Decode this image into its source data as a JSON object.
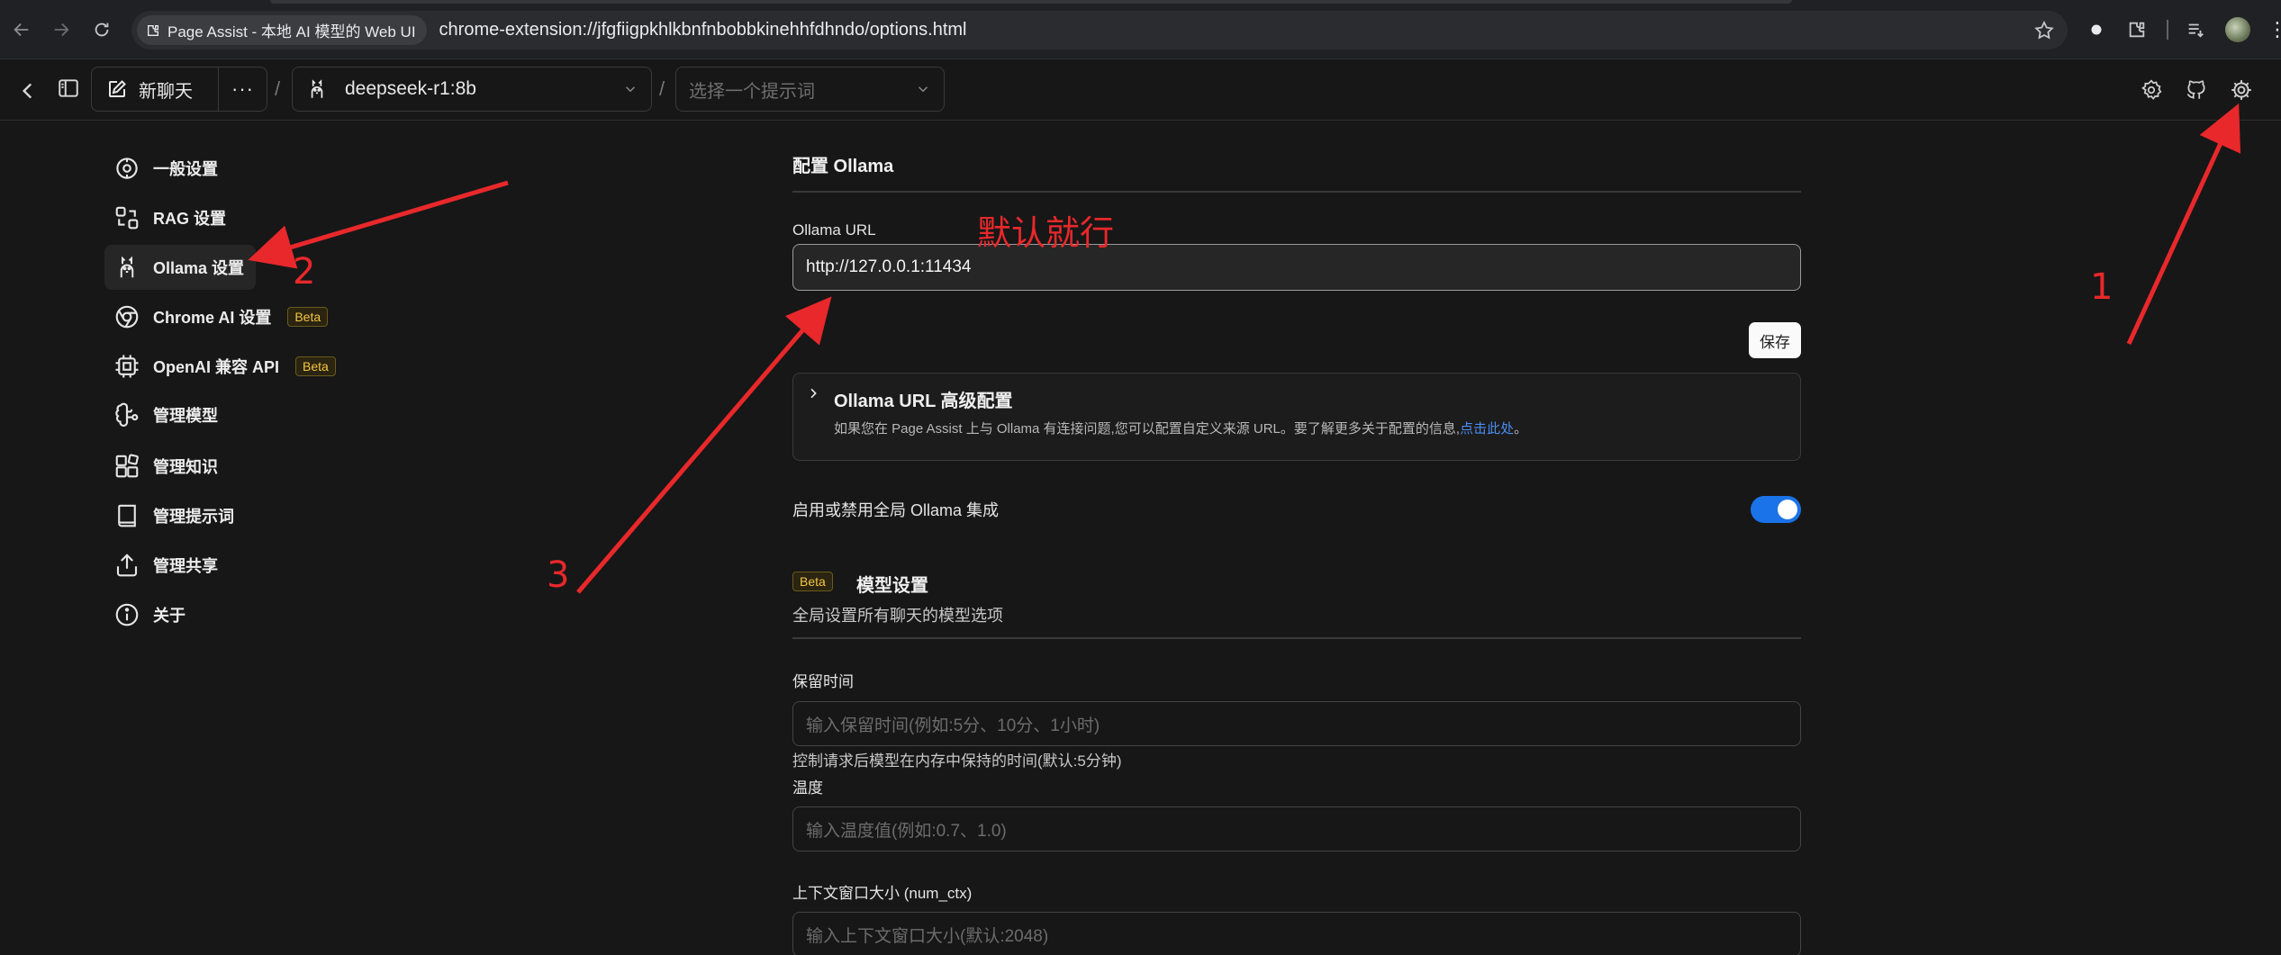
{
  "browser": {
    "tab_title": "Page Assist - 本地 AI 模型的 Web UI",
    "url": "chrome-extension://jfgfiigpkhlkbnfnbobbkinehhfdhndo/options.html"
  },
  "header": {
    "new_chat_label": "新聊天",
    "more_label": "···",
    "model_selected": "deepseek-r1:8b",
    "prompt_placeholder": "选择一个提示词",
    "separator": "/"
  },
  "sidebar": {
    "items": [
      {
        "label": "一般设置",
        "icon": "general-settings-icon"
      },
      {
        "label": "RAG 设置",
        "icon": "rag-settings-icon"
      },
      {
        "label": "Ollama 设置",
        "icon": "llama-icon",
        "active": true
      },
      {
        "label": "Chrome AI 设置",
        "icon": "chrome-icon",
        "badge": "Beta"
      },
      {
        "label": "OpenAI 兼容 API",
        "icon": "chip-icon",
        "badge": "Beta"
      },
      {
        "label": "管理模型",
        "icon": "brain-icon"
      },
      {
        "label": "管理知识",
        "icon": "blocks-icon"
      },
      {
        "label": "管理提示词",
        "icon": "book-icon"
      },
      {
        "label": "管理共享",
        "icon": "share-icon"
      },
      {
        "label": "关于",
        "icon": "info-icon"
      }
    ]
  },
  "main": {
    "section_title": "配置 Ollama",
    "url_label": "Ollama URL",
    "url_value": "http://127.0.0.1:11434",
    "save_label": "保存",
    "advanced": {
      "title": "Ollama URL 高级配置",
      "desc": "如果您在 Page Assist 上与 Ollama 有连接问题,您可以配置自定义来源 URL。要了解更多关于配置的信息,",
      "link": "点击此处",
      "desc_end": "。"
    },
    "toggle_label": "启用或禁用全局 Ollama 集成",
    "toggle_on": true,
    "model_settings": {
      "badge": "Beta",
      "title": "模型设置",
      "subtitle": "全局设置所有聊天的模型选项"
    },
    "keep_alive": {
      "label": "保留时间",
      "placeholder": "输入保留时间(例如:5分、10分、1小时)",
      "hint": "控制请求后模型在内存中保持的时间(默认:5分钟)"
    },
    "temperature": {
      "label": "温度",
      "placeholder": "输入温度值(例如:0.7、1.0)"
    },
    "num_ctx": {
      "label": "上下文窗口大小 (num_ctx)",
      "placeholder": "输入上下文窗口大小(默认:2048)"
    }
  },
  "annotations": {
    "note": "默认就行",
    "step1": "1",
    "step2": "2",
    "step3": "3",
    "color": "#e8282b"
  },
  "colors": {
    "accent_toggle": "#1a73e8",
    "link": "#4a8cf0",
    "beta": "#f5c542"
  }
}
